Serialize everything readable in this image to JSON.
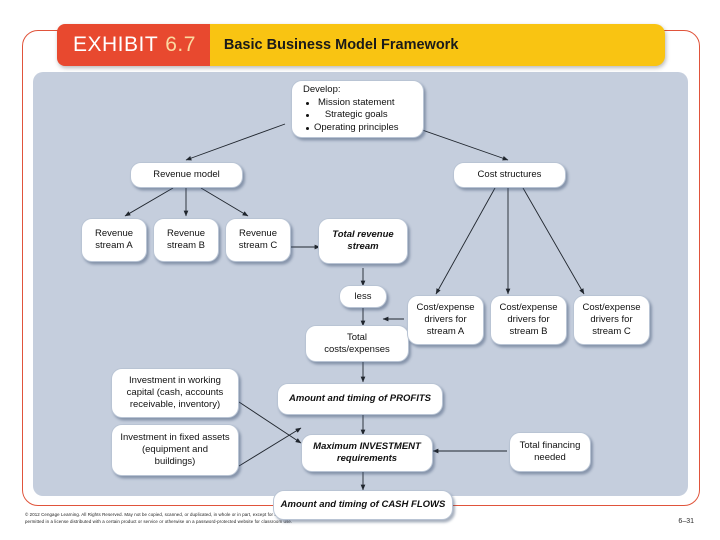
{
  "header": {
    "exhibit_label": "EXHIBIT",
    "exhibit_number": "6.7",
    "title": "Basic Business Model Framework",
    "red_color": "#e8492f",
    "yellow_color": "#f9c412",
    "frame_color": "#e0543b"
  },
  "diagram": {
    "background_color": "#c5cedd",
    "nodes": {
      "develop_heading": "Develop:",
      "develop_bullets": [
        "Mission statement",
        "Strategic goals",
        "Operating principles"
      ],
      "revenue_model": "Revenue model",
      "cost_structures": "Cost structures",
      "revenue_stream_a": "Revenue\nstream A",
      "revenue_stream_b": "Revenue\nstream B",
      "revenue_stream_c": "Revenue\nstream C",
      "total_revenue_stream": "Total revenue\nstream",
      "less": "less",
      "total_costs_expenses": "Total\ncosts/expenses",
      "cost_drivers_a": "Cost/expense\ndrivers for\nstream A",
      "cost_drivers_b": "Cost/expense\ndrivers for\nstream B",
      "cost_drivers_c": "Cost/expense\ndrivers for\nstream C",
      "investment_working_capital": "Investment in working\ncapital (cash, accounts\nreceivable, inventory)",
      "investment_fixed_assets": "Investment in fixed assets\n(equipment and\nbuildings)",
      "amount_timing_profits": "Amount and timing of PROFITS",
      "maximum_investment": "Maximum INVESTMENT\nrequirements",
      "total_financing_needed": "Total financing\nneeded",
      "amount_timing_cash_flows": "Amount and timing of CASH FLOWS"
    }
  },
  "footer": {
    "copyright_line1": "© 2012 Cengage Learning. All Rights Reserved. May not be copied, scanned, or duplicated, in whole or in part, except for use as",
    "copyright_line2": "permitted in a license distributed with a certain product or service or otherwise on a password-protected website for classroom use.",
    "page_number": "6–31"
  }
}
